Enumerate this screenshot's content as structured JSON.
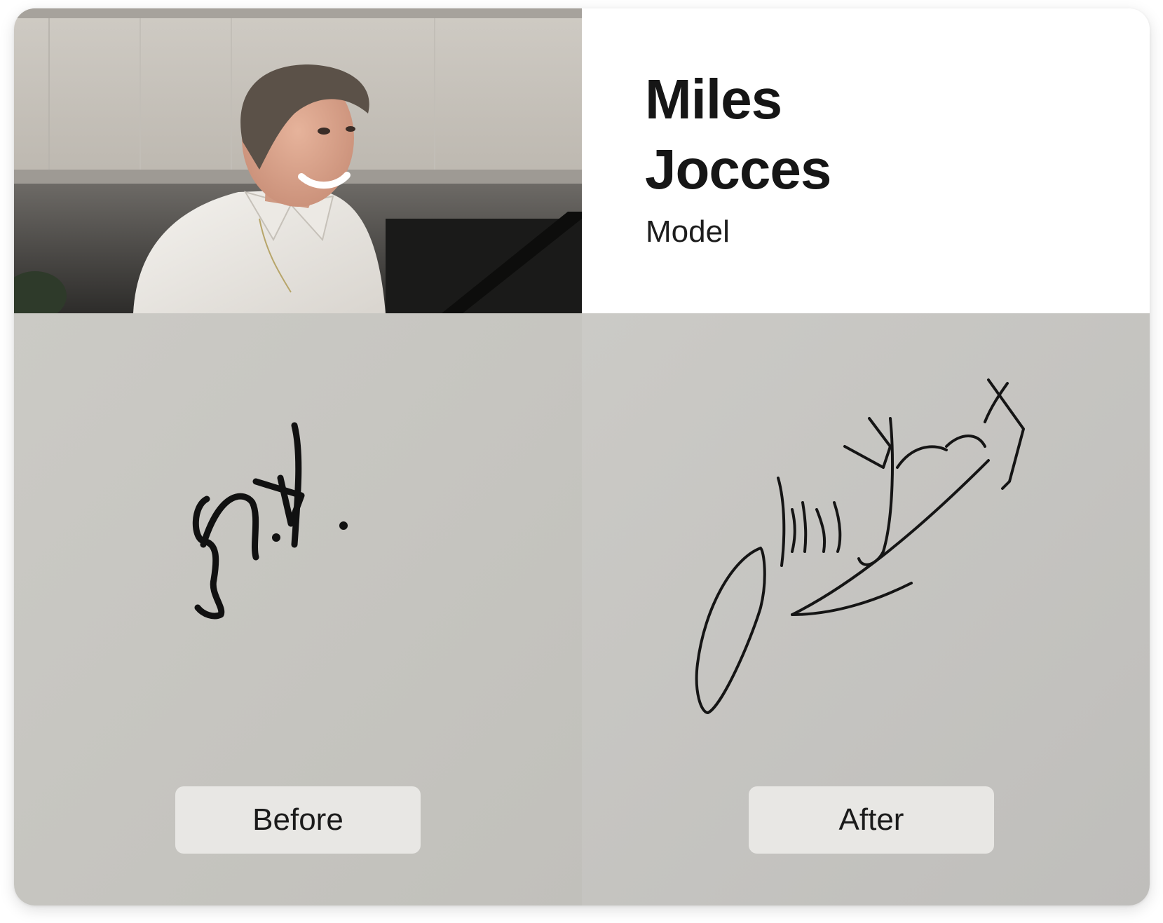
{
  "profile": {
    "first_name": "Miles",
    "last_name": "Jocces",
    "role": "Model"
  },
  "comparison": {
    "before_label": "Before",
    "after_label": "After"
  },
  "colors": {
    "paper_before": "#c9c8c3",
    "paper_after": "#c6c5c1",
    "ink": "#111111",
    "label_bg": "#e8e7e4"
  },
  "icons": {
    "portrait": "person-photo",
    "signature_before": "initials-signature",
    "signature_after": "full-signature"
  }
}
